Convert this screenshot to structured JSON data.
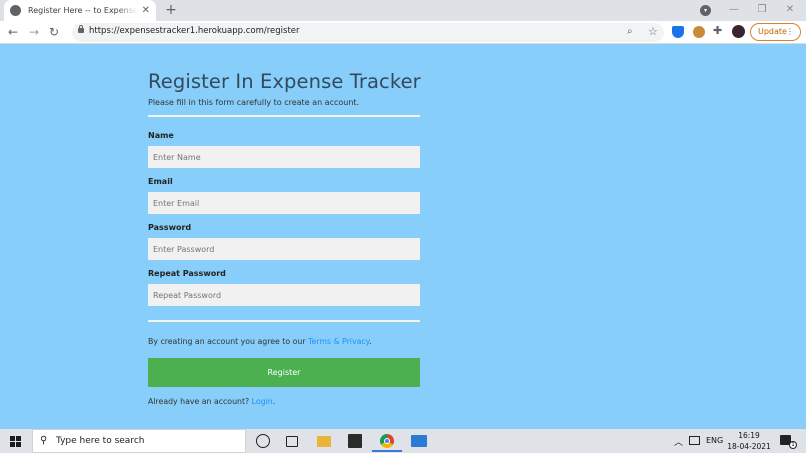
{
  "browser": {
    "tab_title": "Register Here -- to Expense Tracker",
    "tab_close": "✕",
    "new_tab": "+",
    "url": "https://expensestracker1.herokuapp.com/register",
    "update_label": "Update",
    "update_menu": "⋮",
    "back": "←",
    "forward": "→",
    "reload": "↻"
  },
  "form": {
    "title": "Register In Expense Tracker",
    "subtitle": "Please fill in this form carefully to create an account.",
    "fields": [
      {
        "label": "Name",
        "placeholder": "Enter Name"
      },
      {
        "label": "Email",
        "placeholder": "Enter Email"
      },
      {
        "label": "Password",
        "placeholder": "Enter Password"
      },
      {
        "label": "Repeat Password",
        "placeholder": "Repeat Password"
      }
    ],
    "terms_prefix": "By creating an account you agree to our ",
    "terms_link": "Terms & Privacy",
    "terms_suffix": ".",
    "register_label": "Register",
    "signin_prefix": "Already have an account? ",
    "signin_link": "Login",
    "signin_suffix": "."
  },
  "taskbar": {
    "search_placeholder": "Type here to search",
    "language": "ENG",
    "time": "16:19",
    "date": "18-04-2021",
    "notification_count": "1"
  },
  "colors": {
    "page_background": "#87cefa",
    "register_button": "#4caf50",
    "link": "#1e90ff",
    "title": "#344a5c"
  }
}
